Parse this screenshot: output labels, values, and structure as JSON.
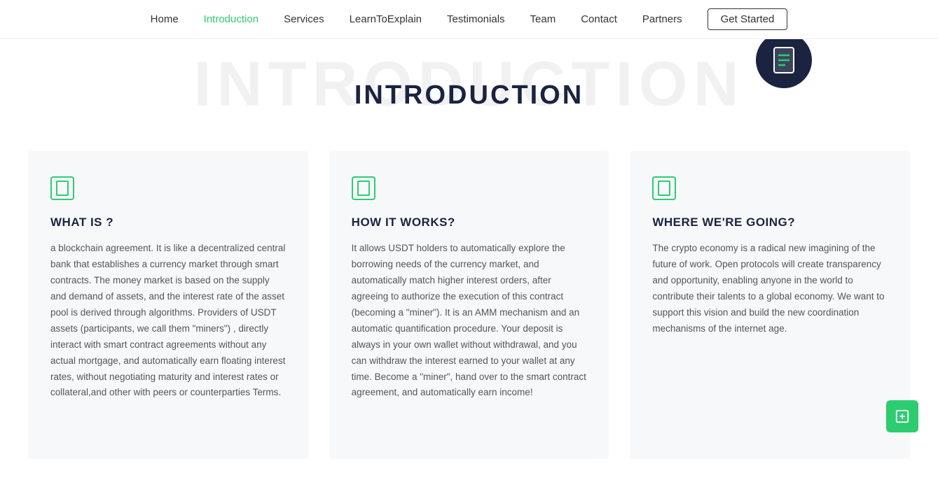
{
  "nav": {
    "links": [
      {
        "label": "Home",
        "active": false,
        "name": "home"
      },
      {
        "label": "Introduction",
        "active": true,
        "name": "introduction"
      },
      {
        "label": "Services",
        "active": false,
        "name": "services"
      },
      {
        "label": "LearnToExplain",
        "active": false,
        "name": "learntoexplain"
      },
      {
        "label": "Testimonials",
        "active": false,
        "name": "testimonials"
      },
      {
        "label": "Team",
        "active": false,
        "name": "team"
      },
      {
        "label": "Contact",
        "active": false,
        "name": "contact"
      },
      {
        "label": "Partners",
        "active": false,
        "name": "partners"
      }
    ],
    "cta": "Get Started"
  },
  "hero": {
    "watermark": "INTRODUCTION",
    "heading": "INTRODUCTION"
  },
  "cards": [
    {
      "id": "what-is",
      "title": "WHAT IS ?",
      "body": "a blockchain agreement. It is like a decentralized central bank that establishes a currency market through smart contracts. The money market is based on the supply and demand of assets, and the interest rate of the asset pool is derived through algorithms. Providers of USDT assets (participants, we call them \"miners\") , directly interact with smart contract agreements without any actual mortgage, and automatically earn floating interest rates, without negotiating maturity and interest rates or collateral,and other with peers or counterparties Terms."
    },
    {
      "id": "how-it-works",
      "title": "HOW IT WORKS?",
      "body": "It allows USDT holders to automatically explore the borrowing needs of the currency market, and automatically match higher interest orders, after agreeing to authorize the execution of this contract (becoming a \"miner\"). It is an AMM mechanism and an automatic quantification procedure. Your deposit is always in your own wallet without withdrawal, and you can withdraw the interest earned to your wallet at any time. Become a \"miner\", hand over to the smart contract agreement, and automatically earn income!"
    },
    {
      "id": "where-going",
      "title": "WHERE WE'RE GOING?",
      "body": "The crypto economy is a radical new imagining of the future of work. Open protocols will create transparency and opportunity, enabling anyone in the world to contribute their talents to a global economy. We want to support this vision and build the new coordination mechanisms of the internet age."
    }
  ]
}
